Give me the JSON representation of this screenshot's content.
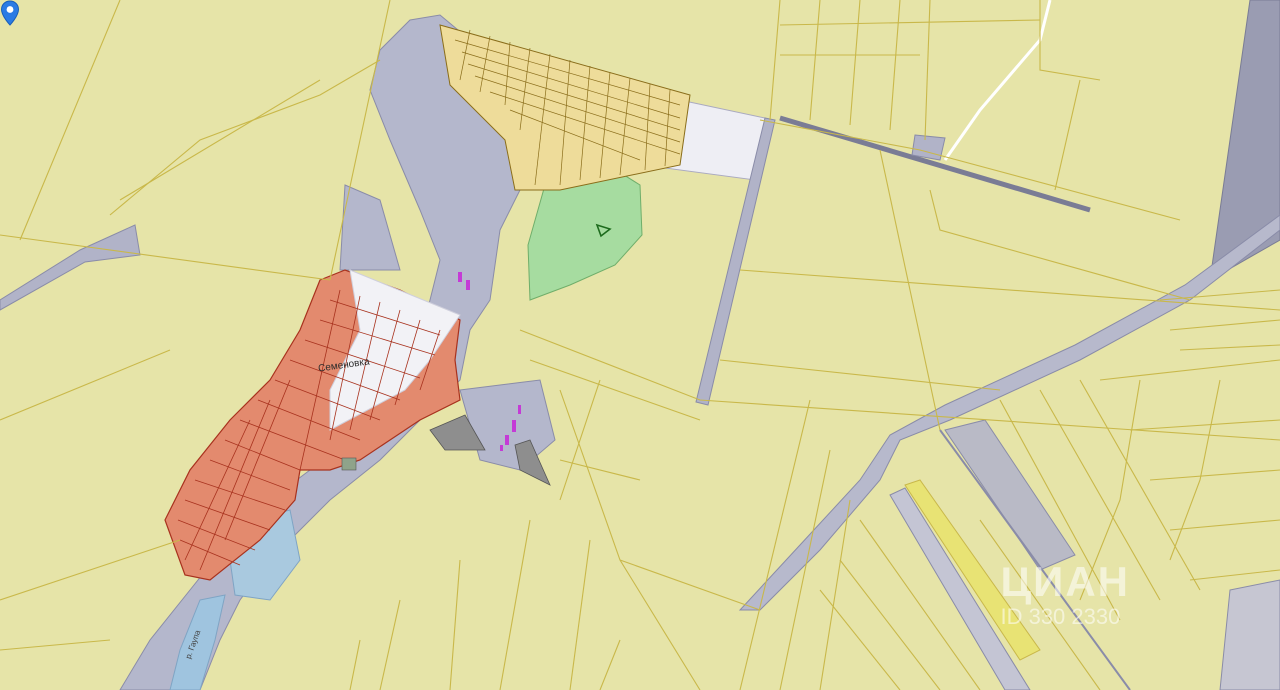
{
  "map": {
    "village_label": "Семеновка",
    "river_label": "р. Гаупа"
  },
  "watermark": {
    "brand": "ЦИАН",
    "id": "ID 330 2330"
  },
  "marker": {
    "color": "#2b7be4"
  },
  "colors": {
    "background": "#e6e4a8",
    "parcel_line": "#c9b84a",
    "settlement": "#e07b5e",
    "settlement_outline": "#a8321e",
    "gray_land": "#b4b7cc",
    "forest": "#a6dca0",
    "water": "#9fc4df"
  }
}
